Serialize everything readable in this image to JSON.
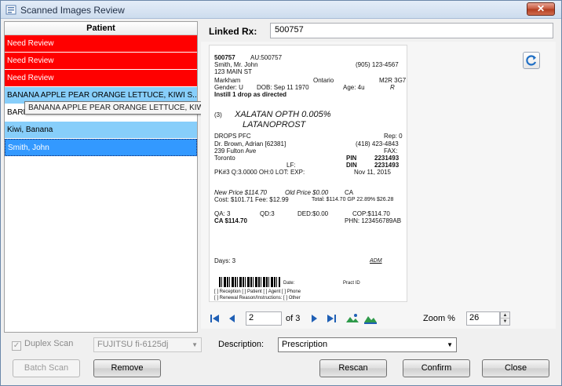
{
  "window": {
    "title": "Scanned Images Review",
    "close_label": "✕",
    "accent": "#3399ff"
  },
  "patients": {
    "header": "Patient",
    "rows": [
      {
        "label": "Need Review"
      },
      {
        "label": "Need Review"
      },
      {
        "label": "Need Review"
      },
      {
        "label": "BANANA APPLE PEAR ORANGE LETTUCE, KIWI S..."
      },
      {
        "label": "BARK"
      },
      {
        "label": "Kiwi, Banana"
      },
      {
        "label": "Smith, John"
      }
    ],
    "tooltip": "BANANA APPLE PEAR ORANGE LETTUCE, KIWI SMITH JONES"
  },
  "linked_rx": {
    "label": "Linked Rx:",
    "value": "500757"
  },
  "scan": {
    "rx_no": "500757",
    "au": "AU:500757",
    "patient_name": "Smith, Mr. John",
    "phone": "(905) 123-4567",
    "address": "123 MAIN ST",
    "city": "Markham",
    "province": "Ontario",
    "postal": "M2R 3G7",
    "gender": "Gender: U",
    "dob": "DOB: Sep 11 1970",
    "age": "Age: 4u",
    "r": "R",
    "sig": "Instill 1 drop as directed",
    "qty_mark": "(3)",
    "drug_line1": "XALATAN OPTH 0.005%",
    "drug_line2": "LATANOPROST",
    "form": "DROPS PFC",
    "rep": "Rep: 0",
    "doctor": "Dr. Brown, Adrian [62381]",
    "doc_phone": "(418) 423-4843",
    "doc_address": "239 Fulton Ave",
    "fax": "FAX:",
    "doc_city": "Toronto",
    "pin_label": "PIN",
    "pin": "2231493",
    "din_label": "DIN",
    "din": "2231493",
    "lf": "LF:",
    "pk_line": "PK#3 Q:3.0000 OH:0  LOT:  EXP:",
    "date": "Nov 11, 2015",
    "new_price": "New Price $114.70",
    "old_price": "Old Price $0.00",
    "ca": "CA",
    "cost_line": "Cost: $101.71   Fee: $12.99",
    "total_line": "Total: $114.70  GP 22.89% $26.28",
    "qa": "QA: 3",
    "qd": "QD:3",
    "ded": "DED:$0.00",
    "cop": "COP:$114.70",
    "ca_amount": "CA $114.70",
    "phn": "PHN: 123456789AB",
    "days": "Days: 3",
    "adm": "ADM",
    "date_label": "Date:",
    "pract_id": "Pract ID",
    "checks1": "[ ] Reception  [ ] Patient  [ ] Agent  [ ] Phone",
    "checks2": "[ ] Renewal   Reason/Instructions: [ ] Other"
  },
  "navigation": {
    "page": "2",
    "of_label": "of 3",
    "zoom_label": "Zoom %",
    "zoom_value": "26"
  },
  "bottom": {
    "duplex_label": "Duplex Scan",
    "scanner": "FUJITSU fi-6125dj",
    "description_label": "Description:",
    "description_value": "Prescription",
    "batch_scan": "Batch Scan",
    "remove": "Remove",
    "rescan": "Rescan",
    "confirm": "Confirm",
    "close": "Close"
  }
}
